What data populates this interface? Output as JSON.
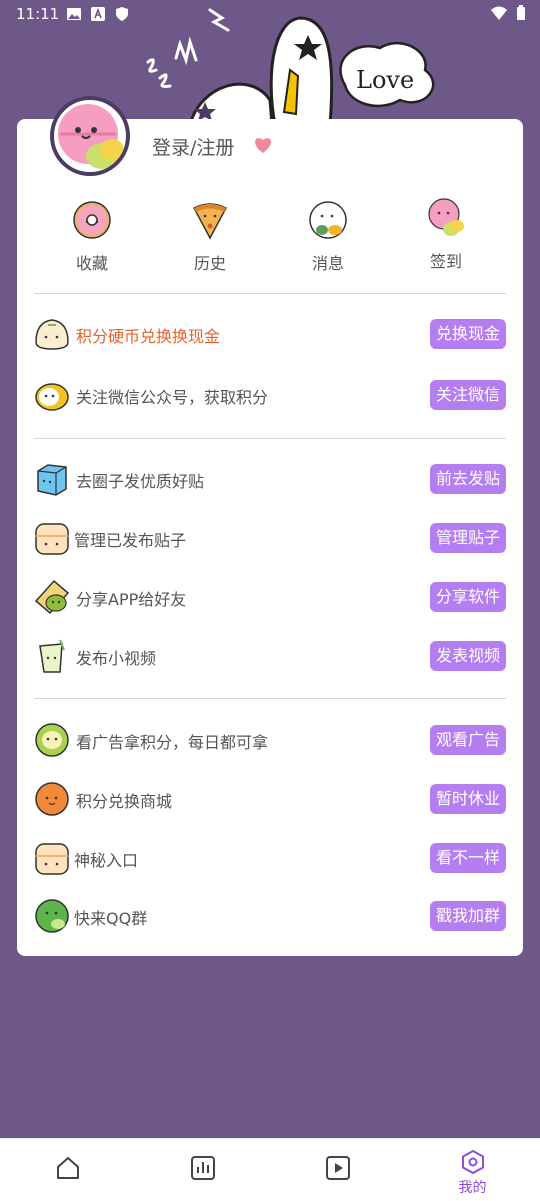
{
  "status_bar": {
    "time": "11:11"
  },
  "profile": {
    "login_label": "登录/注册"
  },
  "quick_actions": [
    {
      "label": "收藏",
      "icon": "donut-icon"
    },
    {
      "label": "历史",
      "icon": "pizza-icon"
    },
    {
      "label": "消息",
      "icon": "sushi-icon"
    },
    {
      "label": "签到",
      "icon": "macaron-icon"
    }
  ],
  "sections": [
    [
      {
        "text": "积分硬币兑换换现金",
        "button": "兑换现金",
        "highlight": true,
        "icon": "bun-icon"
      },
      {
        "text": "关注微信公众号，获取积分",
        "button": "关注微信",
        "icon": "egg-icon"
      }
    ],
    [
      {
        "text": "去圈子发优质好贴",
        "button": "前去发贴",
        "icon": "ice-cube-icon"
      },
      {
        "text": "管理已发布贴子",
        "button": "管理贴子",
        "icon": "cake-icon"
      },
      {
        "text": "分享APP给好友",
        "button": "分享软件",
        "icon": "toast-icon"
      },
      {
        "text": "发布小视频",
        "button": "发表视频",
        "icon": "drink-icon"
      }
    ],
    [
      {
        "text": "看广告拿积分，每日都可拿",
        "button": "观看广告",
        "icon": "green-bun-icon"
      },
      {
        "text": "积分兑换商城",
        "button": "暂时休业",
        "icon": "orange-bun-icon"
      },
      {
        "text": "神秘入口",
        "button": "看不一样",
        "icon": "cake-icon"
      },
      {
        "text": "快来QQ群",
        "button": "戳我加群",
        "icon": "lime-icon"
      }
    ]
  ],
  "nav": [
    {
      "icon": "home-icon"
    },
    {
      "icon": "chart-icon"
    },
    {
      "icon": "play-icon"
    },
    {
      "icon": "hexagon-icon",
      "label": "我的",
      "active": true
    }
  ],
  "colors": {
    "background": "#6e5889",
    "accent": "#b57ef0",
    "highlight_text": "#e8632c",
    "nav_active": "#8a4fd6"
  }
}
